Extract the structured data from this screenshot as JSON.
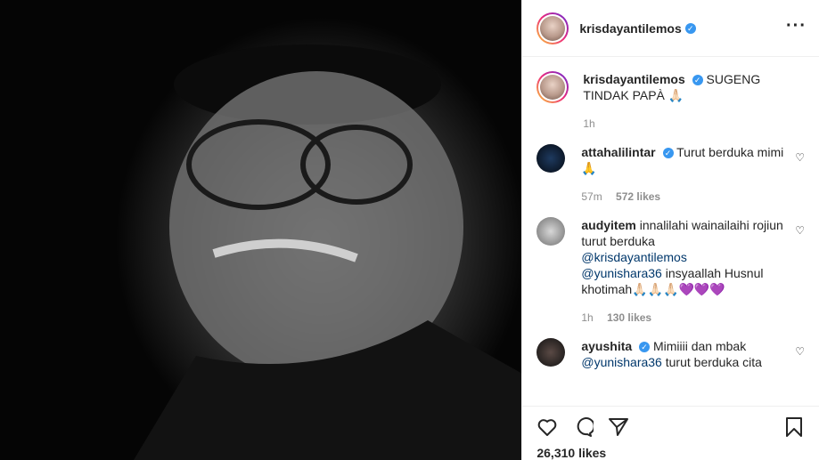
{
  "post": {
    "username": "krisdayantilemos",
    "verified": true
  },
  "caption": {
    "username": "krisdayantilemos",
    "text": "SUGENG TINDAK PAPÀ 🙏🏻",
    "time": "1h"
  },
  "comments": [
    {
      "username": "attahalilintar",
      "text": "Turut berduka mimi 🙏",
      "time": "57m",
      "likes": "572 likes"
    },
    {
      "username": "audyitem",
      "text": "innalilahi wainailaihi rojiun turut berduka",
      "mention1": "@krisdayantilemos",
      "mention2": "@yunishara36",
      "text2": "insyaallah Husnul khotimah🙏🏻🙏🏻🙏🏻💜💜💜",
      "time": "1h",
      "likes": "130 likes"
    },
    {
      "username": "ayushita",
      "text": "Mimiiii dan mbak",
      "mention": "@yunishara36",
      "text2": "turut berduka cita"
    }
  ],
  "footer": {
    "likes": "26,310 likes"
  },
  "icons": {
    "like": "heart-icon",
    "comment": "comment-icon",
    "share": "share-icon",
    "save": "bookmark-icon",
    "more": "more-icon"
  },
  "colors": {
    "verified": "#3897f0",
    "mention": "#00376b",
    "meta": "#8e8e8e"
  }
}
